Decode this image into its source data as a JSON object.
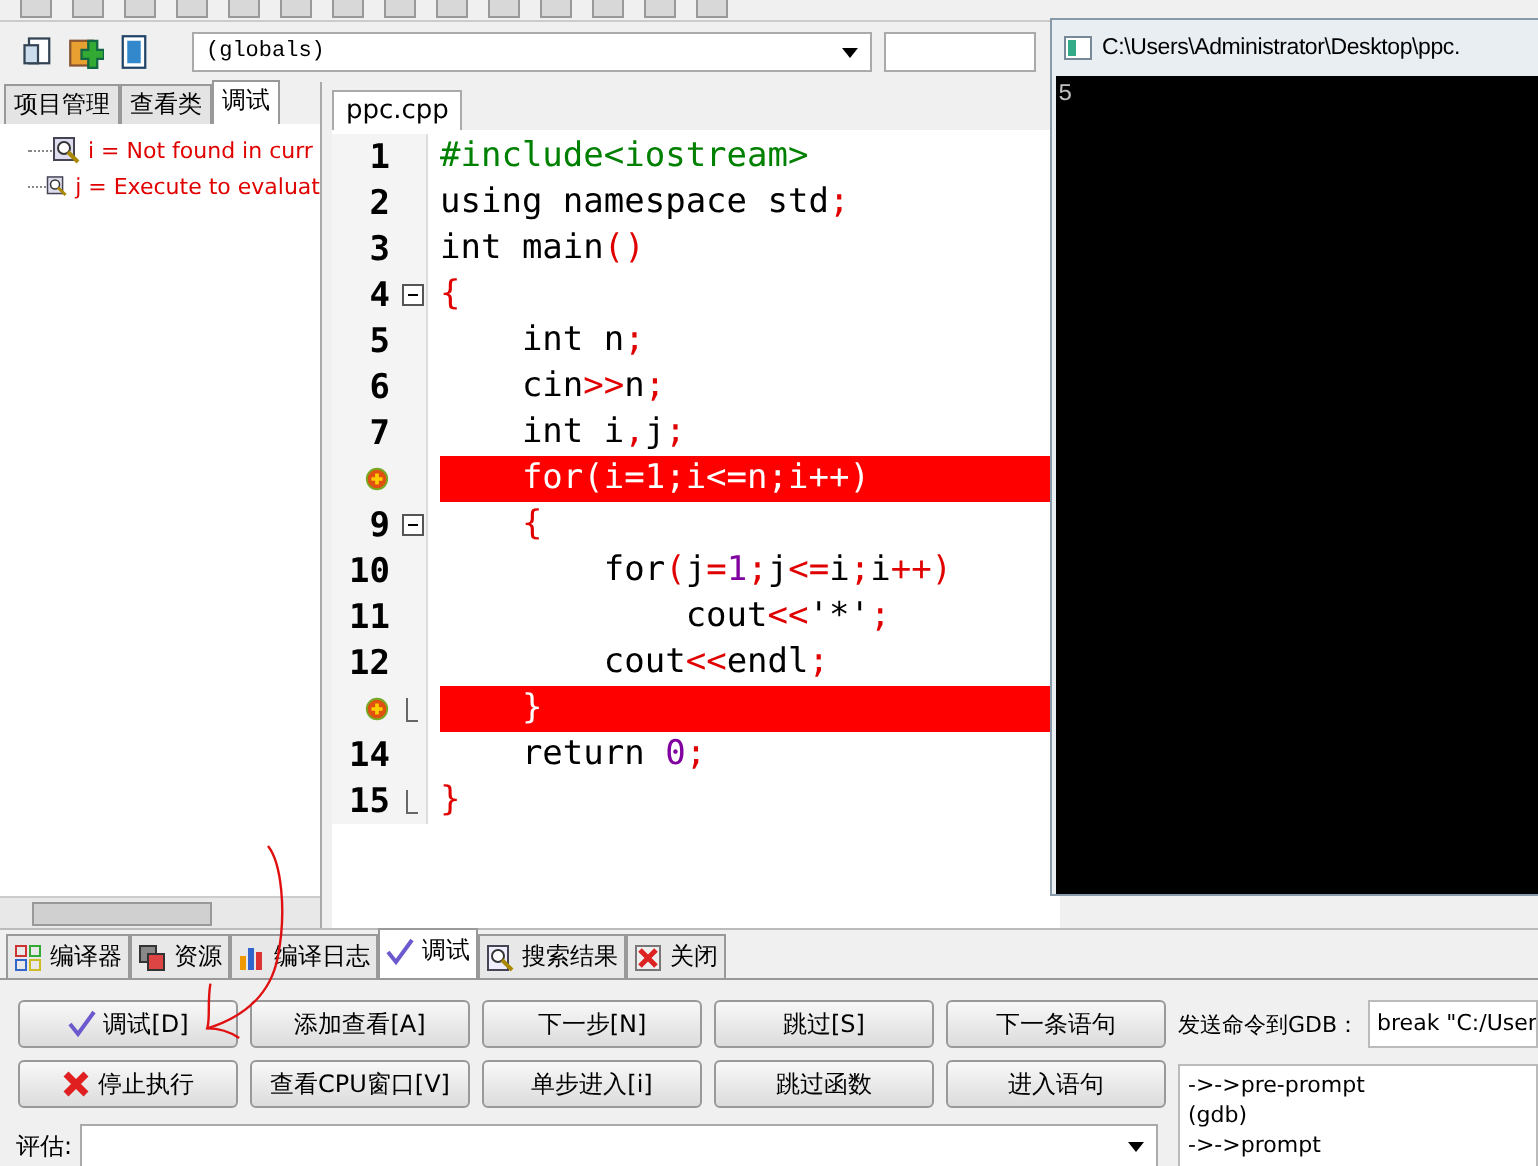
{
  "toolbar": {
    "scope_dropdown": "(globals)"
  },
  "left_panel": {
    "tabs": [
      {
        "label": "项目管理",
        "selected": false
      },
      {
        "label": "查看类",
        "selected": false
      },
      {
        "label": "调试",
        "selected": true
      }
    ],
    "watches": [
      {
        "text": "i = Not found in curr"
      },
      {
        "text": "j = Execute to evaluat"
      }
    ]
  },
  "editor": {
    "tab": "ppc.cpp",
    "lines": [
      {
        "number": "1",
        "segments": [
          {
            "text": "#include<iostream>",
            "kind": "pre"
          }
        ]
      },
      {
        "number": "2",
        "segments": [
          {
            "text": "using namespace std",
            "kind": "code"
          },
          {
            "text": ";",
            "kind": "sym"
          }
        ]
      },
      {
        "number": "3",
        "segments": [
          {
            "text": "int main",
            "kind": "code"
          },
          {
            "text": "()",
            "kind": "sym"
          }
        ]
      },
      {
        "number": "4",
        "collapsible": true,
        "segments": [
          {
            "text": "{",
            "kind": "sym"
          }
        ]
      },
      {
        "number": "5",
        "segments": [
          {
            "text": "    int n",
            "kind": "code"
          },
          {
            "text": ";",
            "kind": "sym"
          }
        ]
      },
      {
        "number": "6",
        "segments": [
          {
            "text": "    cin",
            "kind": "code"
          },
          {
            "text": ">>",
            "kind": "sym"
          },
          {
            "text": "n",
            "kind": "code"
          },
          {
            "text": ";",
            "kind": "sym"
          }
        ]
      },
      {
        "number": "7",
        "segments": [
          {
            "text": "    int i",
            "kind": "code"
          },
          {
            "text": ",",
            "kind": "sym"
          },
          {
            "text": "j",
            "kind": "code"
          },
          {
            "text": ";",
            "kind": "sym"
          }
        ]
      },
      {
        "breakpoint": true,
        "segments": [
          {
            "text": "    for(i=1;i<=n;i++)",
            "kind": "code"
          }
        ]
      },
      {
        "number": "9",
        "collapsible": true,
        "segments": [
          {
            "text": "    {",
            "kind": "sym"
          }
        ]
      },
      {
        "number": "10",
        "segments": [
          {
            "text": "        for",
            "kind": "code"
          },
          {
            "text": "(",
            "kind": "sym"
          },
          {
            "text": "j",
            "kind": "code"
          },
          {
            "text": "=",
            "kind": "sym"
          },
          {
            "text": "1",
            "kind": "num"
          },
          {
            "text": ";",
            "kind": "sym"
          },
          {
            "text": "j",
            "kind": "code"
          },
          {
            "text": "<=",
            "kind": "sym"
          },
          {
            "text": "i",
            "kind": "code"
          },
          {
            "text": ";",
            "kind": "sym"
          },
          {
            "text": "i",
            "kind": "code"
          },
          {
            "text": "++)",
            "kind": "sym"
          }
        ]
      },
      {
        "number": "11",
        "segments": [
          {
            "text": "            cout",
            "kind": "code"
          },
          {
            "text": "<<",
            "kind": "sym"
          },
          {
            "text": "'*'",
            "kind": "code"
          },
          {
            "text": ";",
            "kind": "sym"
          }
        ]
      },
      {
        "number": "12",
        "segments": [
          {
            "text": "        cout",
            "kind": "code"
          },
          {
            "text": "<<",
            "kind": "sym"
          },
          {
            "text": "endl",
            "kind": "code"
          },
          {
            "text": ";",
            "kind": "sym"
          }
        ]
      },
      {
        "breakpoint": true,
        "fold_end": true,
        "segments": [
          {
            "text": "    }",
            "kind": "code"
          }
        ]
      },
      {
        "number": "14",
        "segments": [
          {
            "text": "    return ",
            "kind": "code"
          },
          {
            "text": "0",
            "kind": "num"
          },
          {
            "text": ";",
            "kind": "sym"
          }
        ]
      },
      {
        "number": "15",
        "fold_end": true,
        "segments": [
          {
            "text": "}",
            "kind": "sym"
          }
        ]
      }
    ]
  },
  "console": {
    "title": "C:\\Users\\Administrator\\Desktop\\ppc.",
    "output": "5"
  },
  "bottom_tabs": [
    {
      "label": "编译器",
      "kind": "compiler",
      "selected": false
    },
    {
      "label": "资源",
      "kind": "resources",
      "selected": false
    },
    {
      "label": "编译日志",
      "kind": "log",
      "selected": false
    },
    {
      "label": "调试",
      "kind": "debug",
      "selected": true
    },
    {
      "label": "搜索结果",
      "kind": "search",
      "selected": false
    },
    {
      "label": "关闭",
      "kind": "close",
      "selected": false
    }
  ],
  "debug_buttons": [
    {
      "label": "调试[D]",
      "kind": "debug"
    },
    {
      "label": "添加查看[A]",
      "kind": "plain"
    },
    {
      "label": "下一步[N]",
      "kind": "plain"
    },
    {
      "label": "跳过[S]",
      "kind": "plain"
    },
    {
      "label": "下一条语句",
      "kind": "plain"
    },
    {
      "label": "停止执行",
      "kind": "stop"
    },
    {
      "label": "查看CPU窗口[V]",
      "kind": "plain"
    },
    {
      "label": "单步进入[i]",
      "kind": "plain"
    },
    {
      "label": "跳过函数",
      "kind": "plain"
    },
    {
      "label": "进入语句",
      "kind": "plain"
    }
  ],
  "evaluate_label": "评估:",
  "gdb": {
    "label": "发送命令到GDB：",
    "command": "break \"C:/User",
    "output": [
      "->->pre-prompt",
      "(gdb)",
      "->->prompt"
    ]
  }
}
